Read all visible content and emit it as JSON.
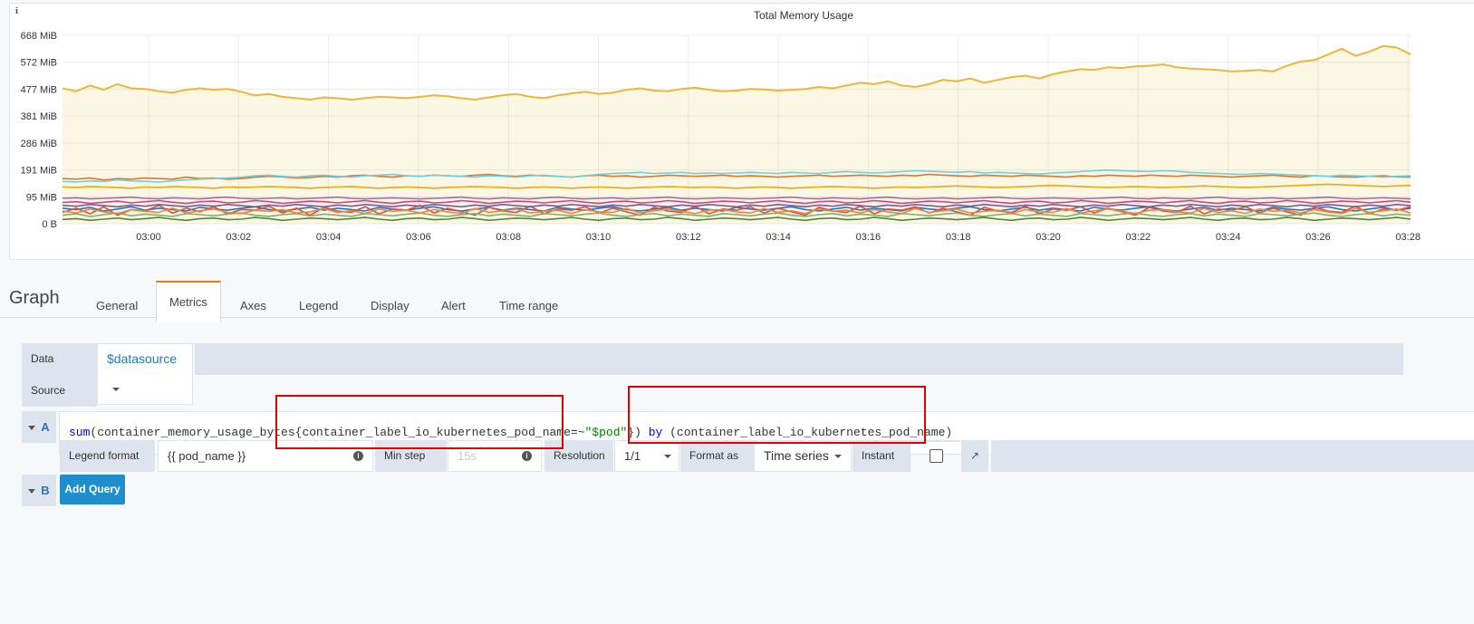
{
  "panel": {
    "info_glyph": "i",
    "title": "Total Memory Usage"
  },
  "chart_data": {
    "type": "line",
    "title": "Total Memory Usage",
    "y_ticks": [
      "668 MiB",
      "572 MiB",
      "477 MiB",
      "381 MiB",
      "286 MiB",
      "191 MiB",
      "95 MiB",
      "0 B"
    ],
    "x_ticks": [
      "03:00",
      "03:02",
      "03:04",
      "03:06",
      "03:08",
      "03:10",
      "03:12",
      "03:14",
      "03:16",
      "03:18",
      "03:20",
      "03:22",
      "03:24",
      "03:26",
      "03:28"
    ],
    "ylim_mib": [
      0,
      668
    ],
    "grid": true,
    "legend": "none",
    "series": [
      {
        "color": "#eab839",
        "fill": true,
        "values": [
          480,
          470,
          490,
          475,
          495,
          480,
          478,
          470,
          465,
          475,
          480,
          475,
          478,
          468,
          455,
          460,
          450,
          445,
          440,
          448,
          445,
          440,
          445,
          450,
          448,
          445,
          450,
          455,
          452,
          445,
          440,
          448,
          455,
          460,
          450,
          445,
          455,
          462,
          468,
          460,
          465,
          475,
          480,
          472,
          470,
          478,
          482,
          475,
          470,
          472,
          478,
          476,
          472,
          475,
          478,
          485,
          480,
          490,
          500,
          495,
          505,
          490,
          485,
          495,
          510,
          505,
          515,
          500,
          510,
          520,
          525,
          515,
          530,
          540,
          548,
          545,
          555,
          552,
          558,
          560,
          565,
          555,
          550,
          548,
          545,
          540,
          542,
          545,
          540,
          560,
          575,
          580,
          600,
          620,
          595,
          610,
          630,
          625,
          600
        ]
      },
      {
        "color": "#e0752d",
        "fill": false,
        "values": [
          160,
          158,
          162,
          155,
          160,
          158,
          162,
          160,
          158,
          165,
          160,
          162,
          158,
          160,
          165,
          168,
          166,
          162,
          164,
          168,
          165,
          170,
          172,
          168,
          165,
          170,
          168,
          172,
          170,
          168,
          172,
          175,
          170,
          168,
          172,
          170,
          168,
          165,
          170,
          172,
          168,
          170,
          165,
          168,
          172,
          170,
          168,
          170,
          172,
          168,
          170,
          168,
          165,
          168,
          170,
          172,
          168,
          170,
          172,
          170,
          168,
          172,
          170,
          175,
          172,
          170,
          168,
          172,
          170,
          168,
          172,
          170,
          168,
          165,
          170,
          168,
          172,
          170,
          168,
          172,
          170,
          168,
          172,
          170,
          168,
          165,
          168,
          170,
          172,
          168,
          165,
          170,
          168,
          166,
          165,
          168,
          170,
          166,
          165
        ]
      },
      {
        "color": "#6ed0e0",
        "fill": false,
        "values": [
          150,
          148,
          152,
          150,
          155,
          152,
          150,
          148,
          152,
          155,
          158,
          160,
          162,
          165,
          170,
          172,
          168,
          165,
          170,
          172,
          168,
          165,
          170,
          172,
          175,
          170,
          168,
          172,
          170,
          168,
          165,
          170,
          168,
          165,
          170,
          172,
          168,
          165,
          170,
          175,
          178,
          180,
          182,
          178,
          180,
          182,
          178,
          180,
          178,
          180,
          182,
          180,
          178,
          182,
          180,
          178,
          182,
          185,
          182,
          180,
          182,
          185,
          188,
          186,
          184,
          182,
          185,
          180,
          182,
          180,
          178,
          176,
          180,
          182,
          185,
          188,
          190,
          188,
          186,
          185,
          188,
          186,
          182,
          180,
          178,
          176,
          175,
          178,
          176,
          174,
          172,
          170,
          168,
          172,
          170,
          168,
          165,
          168,
          170
        ]
      },
      {
        "color": "#e5ac0e",
        "fill": false,
        "values": [
          130,
          128,
          132,
          130,
          128,
          126,
          130,
          128,
          132,
          130,
          128,
          126,
          130,
          128,
          130,
          132,
          130,
          128,
          126,
          128,
          130,
          132,
          128,
          126,
          128,
          130,
          128,
          126,
          128,
          130,
          132,
          130,
          128,
          126,
          128,
          130,
          128,
          126,
          128,
          130,
          128,
          126,
          128,
          130,
          132,
          130,
          128,
          130,
          128,
          126,
          128,
          130,
          128,
          126,
          128,
          130,
          132,
          130,
          128,
          126,
          128,
          130,
          128,
          130,
          132,
          134,
          132,
          130,
          128,
          130,
          132,
          134,
          136,
          134,
          132,
          130,
          128,
          130,
          132,
          130,
          128,
          130,
          132,
          134,
          132,
          130,
          128,
          130,
          132,
          134,
          136,
          138,
          140,
          138,
          136,
          134,
          132,
          134,
          136
        ]
      },
      {
        "color": "#a16eab",
        "fill": false,
        "values": [
          90,
          92,
          88,
          90,
          92,
          94,
          90,
          88,
          92,
          90,
          88,
          92,
          94,
          90,
          88,
          90,
          92,
          88,
          90,
          92,
          94,
          90,
          88,
          90,
          92,
          90,
          88,
          90,
          92,
          94,
          90,
          88,
          92,
          90,
          88,
          92,
          94,
          90,
          88,
          90,
          92,
          88,
          90,
          92,
          94,
          90,
          88,
          90,
          92,
          90,
          88,
          90,
          92,
          94,
          90,
          88,
          92,
          90,
          88,
          92,
          94,
          90,
          88,
          90,
          92,
          88,
          90,
          92,
          94,
          90,
          88,
          90,
          92,
          90,
          88,
          90,
          92,
          94,
          90,
          88,
          92,
          90,
          88,
          92,
          94,
          90,
          88,
          90,
          92,
          88,
          90,
          92,
          94,
          90,
          88,
          90,
          92,
          90,
          88
        ]
      },
      {
        "color": "#d6427f",
        "fill": false,
        "values": [
          75,
          78,
          72,
          76,
          80,
          74,
          78,
          82,
          76,
          72,
          78,
          80,
          74,
          76,
          82,
          78,
          72,
          76,
          80,
          78,
          74,
          78,
          82,
          76,
          72,
          78,
          80,
          74,
          76,
          82,
          78,
          72,
          76,
          80,
          78,
          74,
          78,
          82,
          76,
          72,
          78,
          80,
          74,
          76,
          82,
          78,
          72,
          76,
          80,
          78,
          74,
          78,
          82,
          76,
          72,
          78,
          80,
          74,
          76,
          82,
          78,
          72,
          76,
          80,
          78,
          74,
          78,
          82,
          76,
          72,
          78,
          80,
          74,
          76,
          82,
          78,
          72,
          76,
          80,
          78,
          74,
          78,
          82,
          76,
          72,
          78,
          80,
          74,
          76,
          82,
          78,
          72,
          76,
          80,
          78,
          74,
          78,
          82,
          76
        ]
      },
      {
        "color": "#1f78c1",
        "fill": false,
        "values": [
          55,
          50,
          58,
          45,
          52,
          60,
          48,
          55,
          50,
          45,
          58,
          52,
          48,
          55,
          60,
          50,
          45,
          52,
          58,
          48,
          55,
          50,
          45,
          58,
          52,
          48,
          55,
          60,
          50,
          45,
          52,
          58,
          48,
          55,
          50,
          45,
          58,
          52,
          48,
          55,
          60,
          50,
          45,
          52,
          58,
          48,
          55,
          50,
          45,
          58,
          52,
          48,
          55,
          60,
          50,
          45,
          52,
          58,
          48,
          55,
          50,
          45,
          58,
          52,
          48,
          55,
          60,
          50,
          45,
          52,
          58,
          48,
          55,
          50,
          45,
          58,
          52,
          48,
          55,
          60,
          50,
          45,
          52,
          58,
          48,
          55,
          50,
          45,
          58,
          52,
          48,
          55,
          60,
          50,
          45,
          52,
          58,
          48,
          55
        ]
      },
      {
        "color": "#e24d42",
        "fill": false,
        "values": [
          40,
          55,
          35,
          60,
          30,
          50,
          45,
          65,
          38,
          55,
          42,
          60,
          35,
          50,
          48,
          62,
          38,
          55,
          30,
          58,
          45,
          40,
          60,
          35,
          52,
          48,
          65,
          38,
          55,
          42,
          30,
          58,
          45,
          40,
          62,
          35,
          52,
          48,
          60,
          38,
          55,
          42,
          30,
          58,
          45,
          40,
          62,
          35,
          52,
          48,
          60,
          38,
          55,
          42,
          30,
          58,
          45,
          40,
          62,
          35,
          52,
          48,
          60,
          38,
          55,
          42,
          30,
          58,
          45,
          40,
          62,
          35,
          52,
          48,
          60,
          38,
          55,
          42,
          30,
          58,
          45,
          40,
          62,
          35,
          52,
          48,
          60,
          38,
          55,
          42,
          30,
          58,
          45,
          40,
          62,
          35,
          52,
          48,
          60
        ]
      },
      {
        "color": "#7eb26d",
        "fill": false,
        "values": [
          30,
          35,
          25,
          32,
          38,
          28,
          34,
          30,
          26,
          36,
          32,
          28,
          34,
          38,
          30,
          26,
          32,
          36,
          28,
          34,
          30,
          26,
          36,
          32,
          28,
          34,
          38,
          30,
          26,
          32,
          36,
          28,
          34,
          30,
          26,
          36,
          32,
          28,
          34,
          38,
          30,
          26,
          32,
          36,
          28,
          34,
          30,
          26,
          36,
          32,
          28,
          34,
          38,
          30,
          26,
          32,
          36,
          28,
          34,
          30,
          26,
          36,
          32,
          28,
          34,
          38,
          30,
          26,
          32,
          36,
          28,
          34,
          30,
          26,
          36,
          32,
          28,
          34,
          38,
          30,
          26,
          32,
          36,
          28,
          34,
          30,
          26,
          36,
          32,
          28,
          34,
          38,
          30,
          26,
          32,
          36,
          28,
          34,
          30
        ]
      },
      {
        "color": "#705da0",
        "fill": false,
        "values": [
          65,
          62,
          68,
          64,
          60,
          66,
          62,
          68,
          64,
          60,
          66,
          62,
          68,
          64,
          60,
          66,
          62,
          68,
          64,
          60,
          66,
          62,
          68,
          64,
          60,
          66,
          62,
          68,
          64,
          60,
          66,
          62,
          68,
          64,
          60,
          66,
          62,
          68,
          64,
          60,
          66,
          62,
          68,
          64,
          60,
          66,
          62,
          68,
          64,
          60,
          66,
          62,
          68,
          64,
          60,
          66,
          62,
          68,
          64,
          60,
          66,
          62,
          68,
          64,
          60,
          66,
          62,
          68,
          64,
          60,
          66,
          62,
          68,
          64,
          60,
          66,
          62,
          68,
          64,
          60,
          66,
          62,
          68,
          64,
          60,
          66,
          62,
          68,
          64,
          60,
          66,
          62,
          68,
          64,
          60,
          66,
          62,
          68,
          64
        ]
      },
      {
        "color": "#508642",
        "fill": false,
        "values": [
          15,
          18,
          12,
          16,
          20,
          14,
          18,
          22,
          16,
          12,
          18,
          20,
          14,
          16,
          22,
          18,
          12,
          16,
          20,
          18,
          14,
          18,
          22,
          16,
          12,
          18,
          20,
          14,
          16,
          22,
          18,
          12,
          16,
          20,
          18,
          14,
          18,
          22,
          16,
          12,
          18,
          20,
          14,
          16,
          22,
          18,
          12,
          16,
          20,
          18,
          14,
          18,
          22,
          16,
          12,
          18,
          20,
          14,
          16,
          22,
          18,
          12,
          16,
          20,
          18,
          14,
          18,
          22,
          16,
          12,
          18,
          20,
          14,
          16,
          22,
          18,
          12,
          16,
          20,
          18,
          14,
          18,
          22,
          16,
          12,
          18,
          20,
          14,
          16,
          22,
          18,
          12,
          16,
          20,
          18,
          14,
          18,
          22,
          16
        ]
      },
      {
        "color": "#ef843c",
        "fill": false,
        "values": [
          45,
          38,
          52,
          42,
          36,
          50,
          44,
          40,
          55,
          38,
          46,
          52,
          40,
          36,
          48,
          44,
          50,
          38,
          42,
          54,
          40,
          46,
          36,
          52,
          44,
          48,
          38,
          50,
          42,
          36,
          54,
          40,
          46,
          52,
          38,
          44,
          48,
          36,
          50,
          42,
          40,
          54,
          38,
          46,
          52,
          44,
          36,
          48,
          50,
          42,
          38,
          54,
          40,
          46,
          36,
          52,
          44,
          48,
          38,
          50,
          42,
          36,
          54,
          40,
          46,
          52,
          38,
          44,
          48,
          36,
          50,
          42,
          40,
          54,
          38,
          46,
          52,
          44,
          36,
          48,
          50,
          42,
          38,
          54,
          40,
          46,
          36,
          52,
          44,
          48,
          38,
          50,
          42,
          36,
          54,
          40,
          46,
          52,
          38
        ]
      }
    ]
  },
  "tabs": {
    "graph_label": "Graph",
    "items": [
      "General",
      "Metrics",
      "Axes",
      "Legend",
      "Display",
      "Alert",
      "Time range"
    ],
    "active": "Metrics"
  },
  "datasource": {
    "label": "Data Source",
    "value": "$datasource"
  },
  "query_a": {
    "letter": "A",
    "expr_fn": "sum",
    "expr_part1": "(container_memory_usage_bytes{container_label_io_kubernetes_pod_name=~",
    "expr_string": "\"$pod\"",
    "expr_part2": "}) ",
    "expr_by": "by",
    "expr_part3": " (container_label_io_kubernetes_pod_name)",
    "legend_format_label": "Legend format",
    "legend_format_value": "{{ pod_name }}",
    "min_step_label": "Min step",
    "min_step_placeholder": "15s",
    "resolution_label": "Resolution",
    "resolution_value": "1/1",
    "format_as_label": "Format as",
    "format_as_value": "Time series",
    "instant_label": "Instant",
    "instant_checked": false
  },
  "query_b": {
    "letter": "B",
    "add_query_label": "Add Query"
  },
  "colors": {
    "annotation_box": "#e80000",
    "primary_button": "#1f8ecd",
    "active_tab_accent": "#eb7b18"
  }
}
